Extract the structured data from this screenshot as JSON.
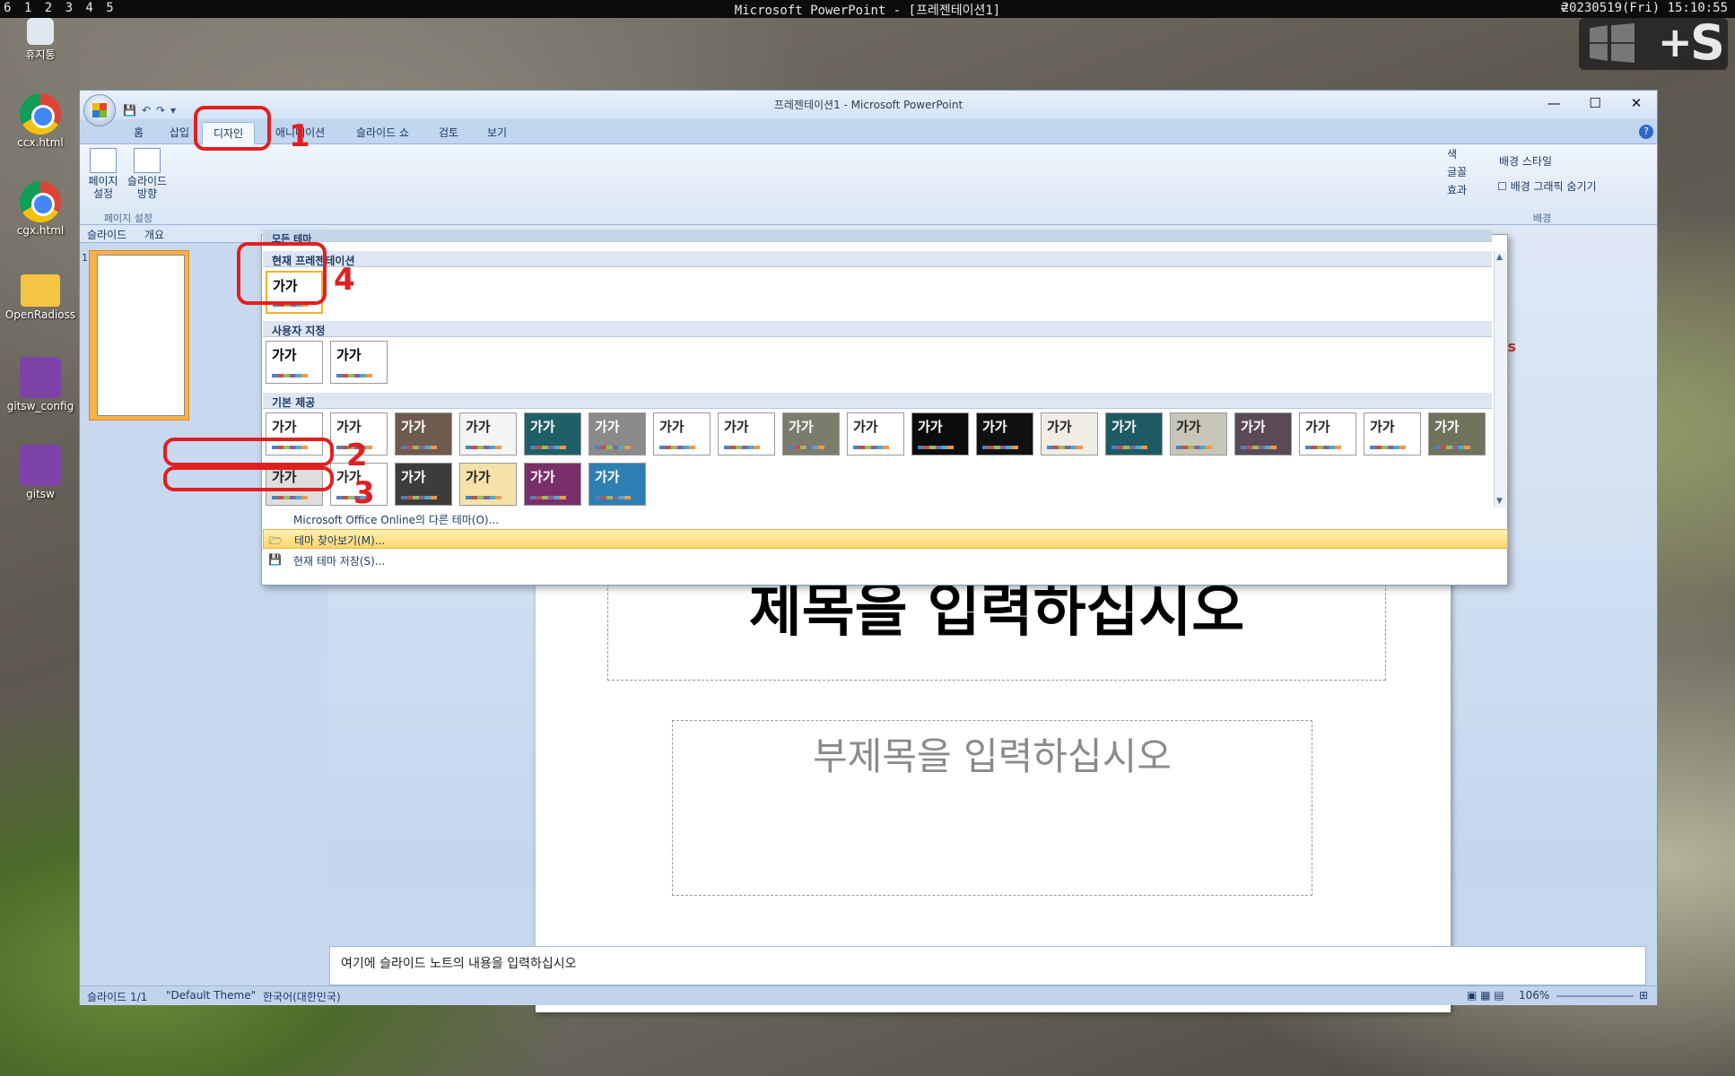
{
  "topbar": {
    "workspaces": "6 1 2 3 4 5",
    "title": "Microsoft PowerPoint - [프레젠테이션1]",
    "clock": "20230519(Fri) 15:10:55"
  },
  "desktop": {
    "icons": [
      "휴지통",
      "ccx.html",
      "cgx.html",
      "OpenRadioss",
      "gitsw_config",
      "gitsw"
    ]
  },
  "window": {
    "title": "프레젠테이션1 - Microsoft PowerPoint"
  },
  "tabs": [
    "홈",
    "삽입",
    "디자인",
    "애니메이션",
    "슬라이드 쇼",
    "검토",
    "보기"
  ],
  "ribbon": {
    "page_setup": "페이지 설정",
    "slide_orient": "슬라이드 방향",
    "group_page": "페이지 설정",
    "colors": "색",
    "fonts": "글꼴",
    "effects": "효과",
    "bg_style": "배경 스타일",
    "hide_bg": "배경 그래픽 숨기기",
    "group_bg": "배경"
  },
  "gallery": {
    "top_label": "모든 테마",
    "current": "현재 프레젠테이션",
    "custom": "사용자 지정",
    "builtin": "기본 제공",
    "thumb_text": "가가",
    "online": "Microsoft Office Online의 다른 테마(O)...",
    "browse": "테마 찾아보기(M)...",
    "save": "현재 테마 저장(S)..."
  },
  "leftpane": {
    "tab_slides": "슬라이드",
    "tab_outline": "개요",
    "num": "1"
  },
  "slide": {
    "title": "제목을 입력하십시오",
    "subtitle": "부제목을 입력하십시오",
    "corner": "cs"
  },
  "notes": "여기에 슬라이드 노트의 내용을 입력하십시오",
  "status": {
    "slide": "슬라이드 1/1",
    "theme": "\"Default Theme\"",
    "lang": "한국어(대한민국)",
    "zoom": "106%"
  },
  "annotations": [
    "1",
    "2",
    "3",
    "4"
  ]
}
